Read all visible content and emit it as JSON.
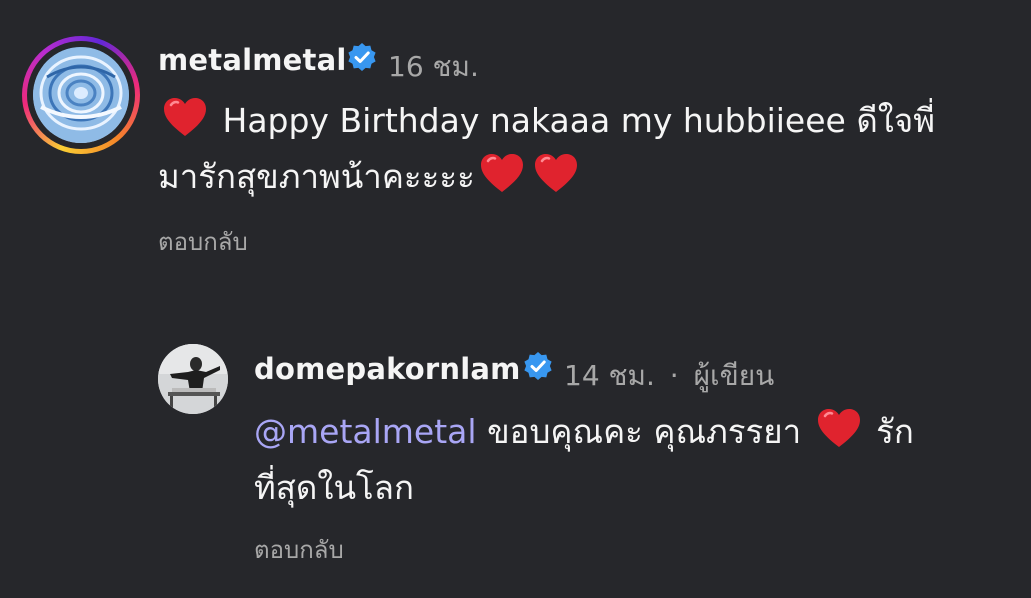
{
  "comment": {
    "username": "metalmetal",
    "time": "16 ชม.",
    "text_line1": "Happy Birthday nakaaa my hubbiieee ดีใจพี่",
    "text_line2": "มารักสุขภาพน้าคะะะะ",
    "reply_label": "ตอบกลับ"
  },
  "reply": {
    "username": "domepakornlam",
    "time": "14 ชม.",
    "separator": "·",
    "author_label": "ผู้เขียน",
    "mention": "@metalmetal",
    "text_part1": "ขอบคุณคะ คุณภรรยา",
    "text_part2": "รัก",
    "text_line2": "ที่สุดในโลก",
    "reply_label": "ตอบกลับ"
  },
  "colors": {
    "background": "#26272b",
    "verified": "#3897f0",
    "mention": "#a9a6f5",
    "heart": "#e0232e",
    "secondary_text": "#a8a8a8"
  },
  "icons": {
    "verified": "verified-badge-icon",
    "heart": "red-heart-emoji"
  }
}
